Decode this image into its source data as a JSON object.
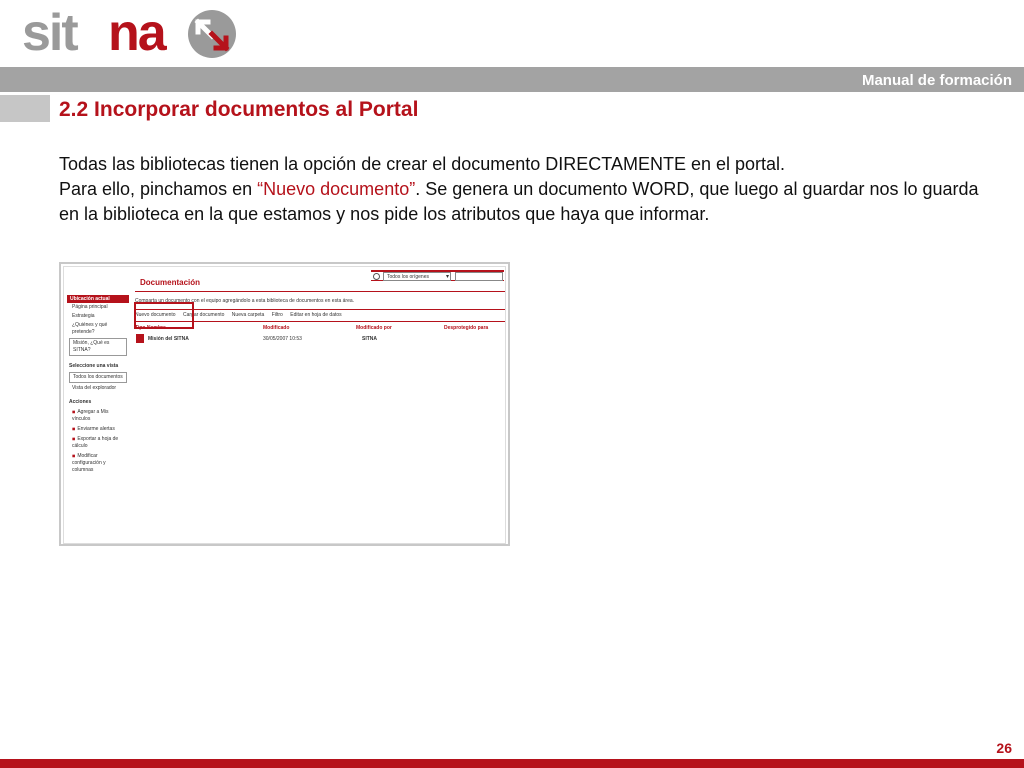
{
  "logo": {
    "text": "sitna",
    "brand_color": "#b5121b",
    "grey_color": "#9a9a9a",
    "icon": "arrows-icon"
  },
  "header": {
    "manual_title": "Manual de formación"
  },
  "section": {
    "title": "2.2 Incorporar documentos al Portal"
  },
  "body": {
    "line1": "Todas las bibliotecas tienen la opción de crear el documento DIRECTAMENTE en el portal.",
    "line2_pre": "Para ello, pinchamos en ",
    "line2_highlight": "“Nuevo documento”",
    "line2_post": ". Se genera un documento WORD, que luego al guardar nos lo guarda en la biblioteca en la que estamos y nos pide los atributos que haya que informar."
  },
  "screenshot": {
    "page_title": "Documentación",
    "search_scope": "Todos los orígenes",
    "nav": {
      "location_head": "Ubicación actual",
      "location_items": [
        "Página principal",
        "Estrategia",
        "¿Quiénes y qué pretende?"
      ],
      "location_boxed": "Misión, ¿Qué es SITNA?",
      "views_head": "Seleccione una vista",
      "views_boxed": "Todos los documentos",
      "views_item": "Vista del explorador",
      "actions_head": "Acciones",
      "actions": [
        "Agregar a Mis vínculos",
        "Enviarme alertas",
        "Exportar a hoja de cálculo",
        "Modificar configuración y columnas"
      ]
    },
    "description": "Comparta un documento con el equipo agregándolo a esta biblioteca de documentos en esta área.",
    "toolbar": [
      "Nuevo documento",
      "Cargar documento",
      "Nueva carpeta",
      "Filtro",
      "Editar en hoja de datos"
    ],
    "columns": [
      "Tipo Nombre",
      "Modificado",
      "Modificado por",
      "Desprotegido para"
    ],
    "row": {
      "name": "Misión del SITNA",
      "modified": "30/05/2007 10:53",
      "modified_by": "SITNA"
    }
  },
  "footer": {
    "page_number": "26"
  }
}
